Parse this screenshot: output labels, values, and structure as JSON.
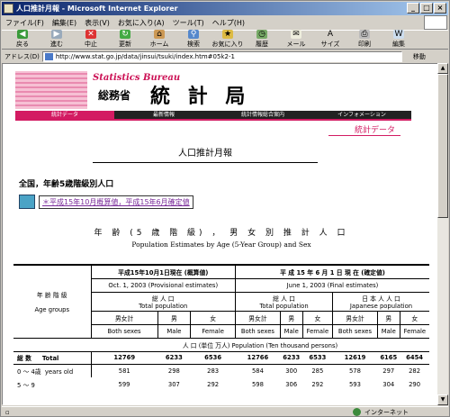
{
  "window": {
    "title": "人口推計月報 - Microsoft Internet Explorer",
    "buttons": [
      "_",
      "□",
      "×"
    ]
  },
  "menu": [
    "ファイル(F)",
    "編集(E)",
    "表示(V)",
    "お気に入り(A)",
    "ツール(T)",
    "ヘルプ(H)"
  ],
  "toolbar": [
    {
      "label": "戻る",
      "icon": "back-arrow-icon"
    },
    {
      "label": "進む",
      "icon": "forward-arrow-icon"
    },
    {
      "label": "中止",
      "icon": "stop-icon"
    },
    {
      "label": "更新",
      "icon": "refresh-icon"
    },
    {
      "label": "ホーム",
      "icon": "home-icon"
    },
    {
      "label": "検索",
      "icon": "search-icon"
    },
    {
      "label": "お気に入り",
      "icon": "favorites-icon"
    },
    {
      "label": "履歴",
      "icon": "history-icon"
    },
    {
      "label": "メール",
      "icon": "mail-icon"
    },
    {
      "label": "サイズ",
      "icon": "font-size-icon"
    },
    {
      "label": "印刷",
      "icon": "print-icon"
    },
    {
      "label": "編集",
      "icon": "edit-icon"
    }
  ],
  "address": {
    "label": "アドレス(D)",
    "url": "http://www.stat.go.jp/data/jinsui/tsuki/index.htm#05k2-1",
    "go": "移動"
  },
  "banner": {
    "sb": "Statistics Bureau",
    "somu": "総務省",
    "tokei": "統 計 局"
  },
  "nav": [
    "統計データ",
    "最新情報",
    "統計情報総合案内",
    "インフォメーション"
  ],
  "section": "統計データ",
  "page_title": "人口推計月報",
  "subtitle": "全国，年齢5歳階級別人口",
  "link_text": "＊平成15年10月概算値，平成15年6月確定値",
  "table_title_jp": "年 齢 (5 歳 階 級) ， 男 女 別 推 計 人 口",
  "table_title_en": "Population Estimates by  Age (5-Year Group) and  Sex",
  "table": {
    "agegroup_jp": "年 齢 階 級",
    "agegroup_en": "Age groups",
    "h_oct": "平成15年10月1日現在 (概算値)",
    "h_oct_en": "Oct. 1, 2003 (Provisional estimates)",
    "h_jun": "平 成 15 年 6 月 1 日 現 在 (確定値)",
    "h_jun_en": "June 1, 2003 (Final estimates)",
    "tp_oct": "総 人 口",
    "tp_oct_en": "Total population",
    "tp_jun": "総 人 口",
    "tp_jun_en": "Total population",
    "jp_jun": "日 本 人 人 口",
    "jp_jun_en": "Japanese population",
    "cols": [
      "男女計",
      "男",
      "女",
      "男女計",
      "男",
      "女",
      "男女計",
      "男",
      "女"
    ],
    "cols_en": [
      "Both sexes",
      "Male",
      "Female",
      "Both sexes",
      "Male",
      "Female",
      "Both sexes",
      "Male",
      "Female"
    ],
    "unit": "人 口 (単位 万人)  Population (Ten thousand persons)",
    "rows": [
      {
        "jp": "総 数",
        "en": "Total",
        "v": [
          "12769",
          "6233",
          "6536",
          "12766",
          "6233",
          "6533",
          "12619",
          "6165",
          "6454"
        ]
      },
      {
        "jp": "0 〜 4歳",
        "en": "years old",
        "v": [
          "581",
          "298",
          "283",
          "584",
          "300",
          "285",
          "578",
          "297",
          "282"
        ]
      },
      {
        "jp": "5 〜 9",
        "en": "",
        "v": [
          "599",
          "307",
          "292",
          "598",
          "306",
          "292",
          "593",
          "304",
          "290"
        ]
      }
    ]
  },
  "status": {
    "text": "インターネット"
  }
}
